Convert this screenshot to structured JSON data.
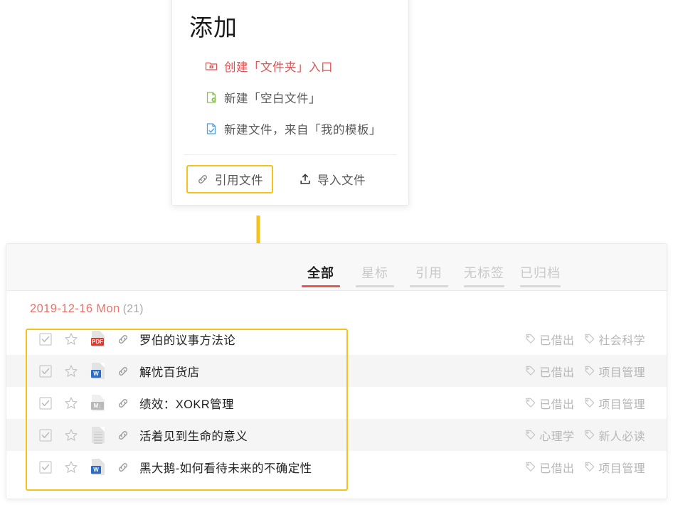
{
  "add_popup": {
    "title": "添加",
    "menu_items": [
      {
        "label": "创建「文件夹」入口",
        "icon": "folder-add-icon",
        "accent_color": "#e05252"
      },
      {
        "label": "新建「空白文件」",
        "icon": "file-add-icon",
        "accent_color": "#8cc152"
      },
      {
        "label": "新建文件，来自「我的模板」",
        "icon": "file-template-icon",
        "accent_color": "#4aa3df"
      }
    ],
    "footer_buttons": [
      {
        "label": "引用文件",
        "icon": "link-icon",
        "highlighted": true
      },
      {
        "label": "导入文件",
        "icon": "upload-icon",
        "highlighted": false
      }
    ]
  },
  "annotation": {
    "arrow_color": "#f5c21b",
    "highlight_color": "#f5c21b"
  },
  "list_card": {
    "tabs": [
      {
        "label": "全部",
        "active": true
      },
      {
        "label": "星标",
        "active": false
      },
      {
        "label": "引用",
        "active": false
      },
      {
        "label": "无标签",
        "active": false
      },
      {
        "label": "已归档",
        "active": false
      }
    ],
    "active_tab_color": "#e8544f",
    "date_group": {
      "date": "2019-12-16 Mon",
      "count": "(21)"
    },
    "rows": [
      {
        "checked": true,
        "starred": false,
        "file_type": "pdf",
        "file_type_label": "PDF",
        "linked": true,
        "title": "罗伯的议事方法论",
        "tags": [
          "已借出",
          "社会科学"
        ]
      },
      {
        "checked": true,
        "starred": false,
        "file_type": "word",
        "file_type_label": "W",
        "linked": true,
        "title": "解忧百货店",
        "tags": [
          "已借出",
          "项目管理"
        ]
      },
      {
        "checked": true,
        "starred": false,
        "file_type": "markdown",
        "file_type_label": "M↓",
        "linked": true,
        "title": "绩效：XOKR管理",
        "tags": [
          "已借出",
          "项目管理"
        ]
      },
      {
        "checked": true,
        "starred": false,
        "file_type": "document",
        "file_type_label": "",
        "linked": true,
        "title": "活着见到生命的意义",
        "tags": [
          "心理学",
          "新人必读"
        ]
      },
      {
        "checked": true,
        "starred": false,
        "file_type": "word",
        "file_type_label": "W",
        "linked": true,
        "title": "黑大鹅-如何看待未来的不确定性",
        "tags": [
          "已借出",
          "项目管理"
        ]
      }
    ]
  }
}
